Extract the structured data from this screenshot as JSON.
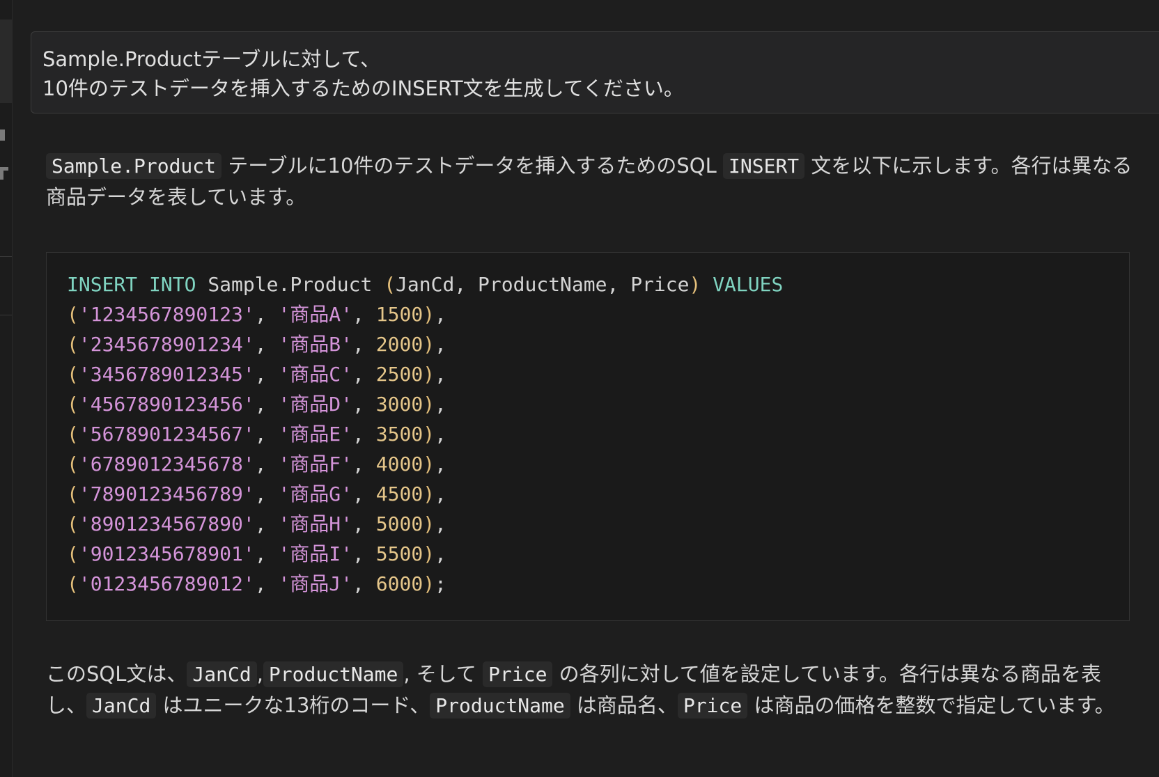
{
  "prompt": {
    "line1": "Sample.Productテーブルに対して、",
    "line2": "10件のテストデータを挿入するためのINSERT文を生成してください。"
  },
  "intro": {
    "code1": "Sample.Product",
    "text1": " テーブルに10件のテストデータを挿入するためのSQL ",
    "code2": "INSERT",
    "text2": " 文を以下に示します。各行は異なる商品データを表しています。"
  },
  "code": {
    "header": {
      "kw_insert": "INSERT",
      "kw_into": "INTO",
      "table": "Sample.Product",
      "open": "(",
      "columns": "JanCd, ProductName, Price",
      "close": ")",
      "kw_values": "VALUES"
    },
    "rows": [
      {
        "jan": "'1234567890123'",
        "name": "'商品A'",
        "price": "1500",
        "end": ","
      },
      {
        "jan": "'2345678901234'",
        "name": "'商品B'",
        "price": "2000",
        "end": ","
      },
      {
        "jan": "'3456789012345'",
        "name": "'商品C'",
        "price": "2500",
        "end": ","
      },
      {
        "jan": "'4567890123456'",
        "name": "'商品D'",
        "price": "3000",
        "end": ","
      },
      {
        "jan": "'5678901234567'",
        "name": "'商品E'",
        "price": "3500",
        "end": ","
      },
      {
        "jan": "'6789012345678'",
        "name": "'商品F'",
        "price": "4000",
        "end": ","
      },
      {
        "jan": "'7890123456789'",
        "name": "'商品G'",
        "price": "4500",
        "end": ","
      },
      {
        "jan": "'8901234567890'",
        "name": "'商品H'",
        "price": "5000",
        "end": ","
      },
      {
        "jan": "'9012345678901'",
        "name": "'商品I'",
        "price": "5500",
        "end": ","
      },
      {
        "jan": "'0123456789012'",
        "name": "'商品J'",
        "price": "6000",
        "end": ";"
      }
    ]
  },
  "outro": {
    "t1": "このSQL文は、",
    "c1": "JanCd",
    "t2": ",",
    "c2": "ProductName",
    "t3": ", そして ",
    "c3": "Price",
    "t4": " の各列に対して値を設定しています。各行は異なる商品を表し、",
    "c4": "JanCd",
    "t5": " はユニークな13桁のコード、",
    "c5": "ProductName",
    "t6": " は商品名、",
    "c6": "Price",
    "t7": " は商品の価格を整数で指定しています。"
  }
}
